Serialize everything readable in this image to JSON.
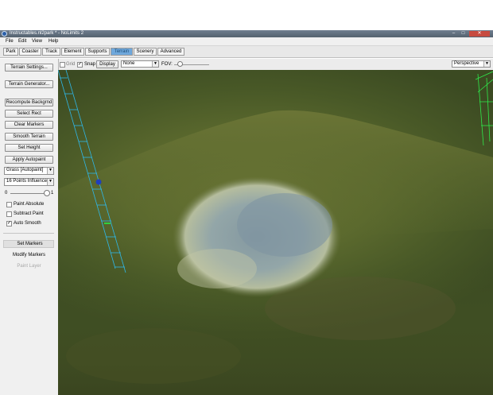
{
  "window": {
    "title": "Instructables.nl2park * - NoLimits 2"
  },
  "menu": [
    "File",
    "Edit",
    "View",
    "Help"
  ],
  "tabs": [
    "Park",
    "Coaster",
    "Track",
    "Element",
    "Supports",
    "Terrain",
    "Scenery",
    "Advanced"
  ],
  "active_tab": "Terrain",
  "toolbar": {
    "grid_label": "Grid",
    "grid_checked": false,
    "snap_label": "Snap",
    "snap_checked": true,
    "display_button": "Display",
    "display_select": "None",
    "fov_label": "FOV:",
    "view_mode": "Perspective"
  },
  "sidebar": {
    "terrain_settings": "Terrain Settings...",
    "terrain_generator": "Terrain Generator...",
    "actions": [
      "Recompute Backgrnd",
      "Select Rect",
      "Clear Markers",
      "Smooth Terrain",
      "Set Height",
      "Apply Autopaint"
    ],
    "paint_select": "Grass [Autopaint]",
    "points_select": "16 Points Influence",
    "slider_min": "0",
    "slider_max": "1",
    "checkboxes": [
      {
        "label": "Paint Absolute",
        "checked": false
      },
      {
        "label": "Subtract Paint",
        "checked": false
      },
      {
        "label": "Auto Smooth",
        "checked": true
      }
    ],
    "modes": [
      "Set Markers",
      "Modify Markers",
      "Paint Layer"
    ]
  },
  "colors": {
    "active_tab": "#6fa8dc",
    "grid_line": "#2fb7e8",
    "terrain": "#56652b",
    "water": "#8fa3a8"
  }
}
